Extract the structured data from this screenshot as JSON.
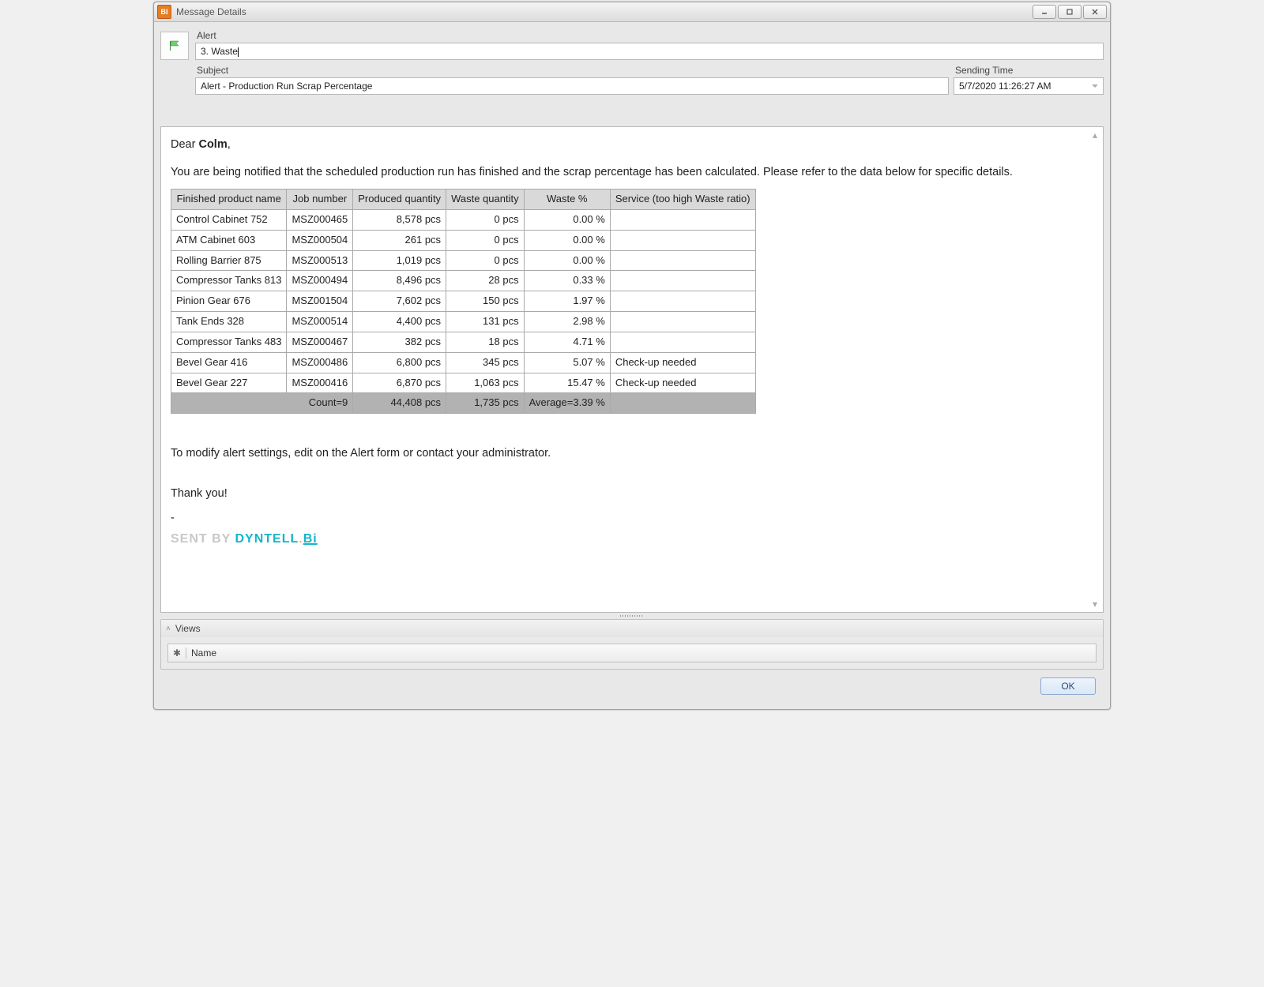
{
  "window": {
    "title": "Message Details"
  },
  "header": {
    "alert_label": "Alert",
    "alert_value": "3. Waste",
    "subject_label": "Subject",
    "subject_value": "Alert - Production Run Scrap Percentage",
    "sending_time_label": "Sending Time",
    "sending_time_value": "5/7/2020 11:26:27 AM"
  },
  "message": {
    "greeting_prefix": "Dear ",
    "recipient": "Colm",
    "greeting_suffix": ",",
    "intro": "You are being notified that the scheduled production run has finished and the scrap percentage has been calculated. Please refer to the data below for specific details.",
    "modify_note": "To modify alert settings, edit on the Alert form or contact your administrator.",
    "thanks": "Thank you!",
    "sentby_prefix": "SENT BY ",
    "brand1": "DYNTELL",
    "brand_dot": ".",
    "brand2": "Bi"
  },
  "table": {
    "columns": [
      "Finished product name",
      "Job number",
      "Produced quantity",
      "Waste quantity",
      "Waste %",
      "Service (too high Waste ratio)"
    ],
    "rows": [
      {
        "name": "Control Cabinet 752",
        "job": "MSZ000465",
        "produced": "8,578 pcs",
        "waste": "0 pcs",
        "pct": "0.00 %",
        "service": ""
      },
      {
        "name": "ATM Cabinet 603",
        "job": "MSZ000504",
        "produced": "261 pcs",
        "waste": "0 pcs",
        "pct": "0.00 %",
        "service": ""
      },
      {
        "name": "Rolling Barrier 875",
        "job": "MSZ000513",
        "produced": "1,019 pcs",
        "waste": "0 pcs",
        "pct": "0.00 %",
        "service": ""
      },
      {
        "name": "Compressor Tanks 813",
        "job": "MSZ000494",
        "produced": "8,496 pcs",
        "waste": "28 pcs",
        "pct": "0.33 %",
        "service": ""
      },
      {
        "name": "Pinion Gear 676",
        "job": "MSZ001504",
        "produced": "7,602 pcs",
        "waste": "150 pcs",
        "pct": "1.97 %",
        "service": ""
      },
      {
        "name": "Tank Ends 328",
        "job": "MSZ000514",
        "produced": "4,400 pcs",
        "waste": "131 pcs",
        "pct": "2.98 %",
        "service": ""
      },
      {
        "name": "Compressor Tanks 483",
        "job": "MSZ000467",
        "produced": "382 pcs",
        "waste": "18 pcs",
        "pct": "4.71 %",
        "service": ""
      },
      {
        "name": "Bevel Gear 416",
        "job": "MSZ000486",
        "produced": "6,800 pcs",
        "waste": "345 pcs",
        "pct": "5.07 %",
        "service": "Check-up needed"
      },
      {
        "name": "Bevel Gear 227",
        "job": "MSZ000416",
        "produced": "6,870 pcs",
        "waste": "1,063 pcs",
        "pct": "15.47 %",
        "service": "Check-up needed"
      }
    ],
    "totals": {
      "count": "Count=9",
      "produced": "44,408 pcs",
      "waste": "1,735 pcs",
      "avg": "Average=3.39 %",
      "service": ""
    }
  },
  "views": {
    "title": "Views",
    "col_name": "Name"
  },
  "footer": {
    "ok": "OK"
  }
}
